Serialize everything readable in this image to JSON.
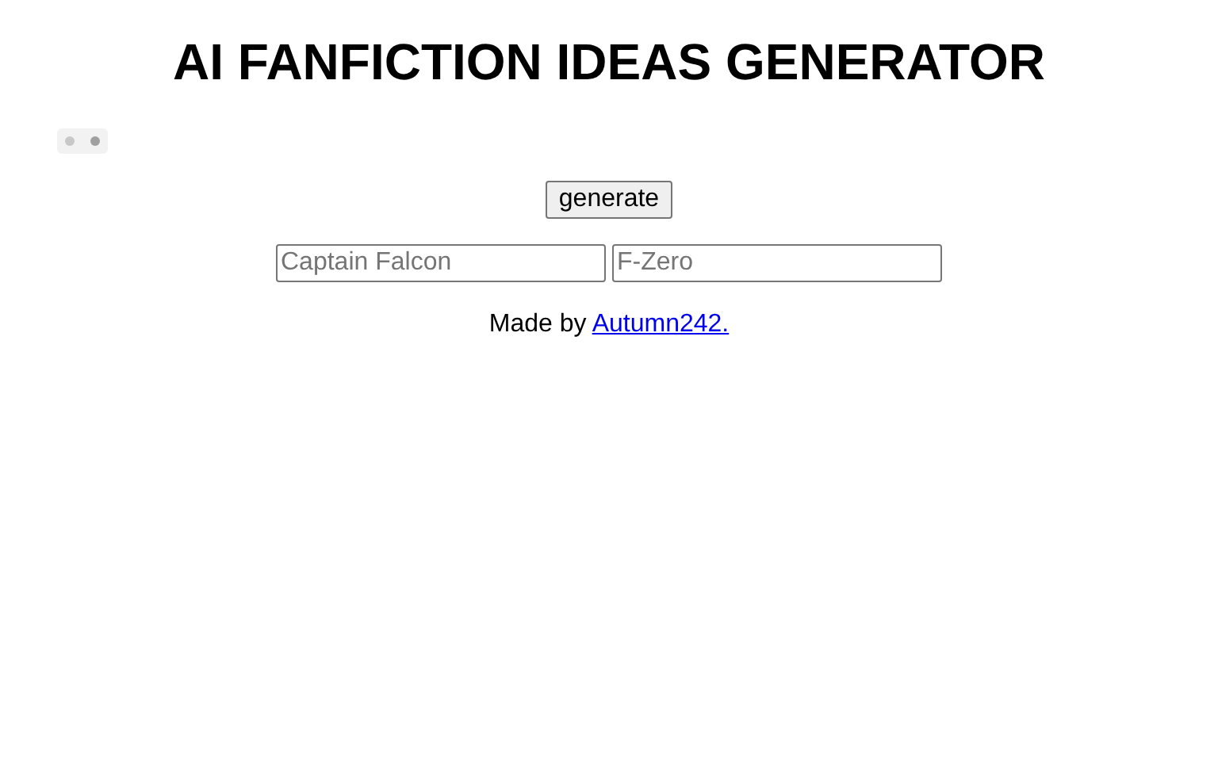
{
  "title": "AI FANFICTION IDEAS GENERATOR",
  "generate_button": {
    "label": "generate"
  },
  "inputs": [
    {
      "placeholder": "Captain Falcon"
    },
    {
      "placeholder": "F-Zero"
    }
  ],
  "footer": {
    "text": "Made by ",
    "link": "Autumn242."
  }
}
